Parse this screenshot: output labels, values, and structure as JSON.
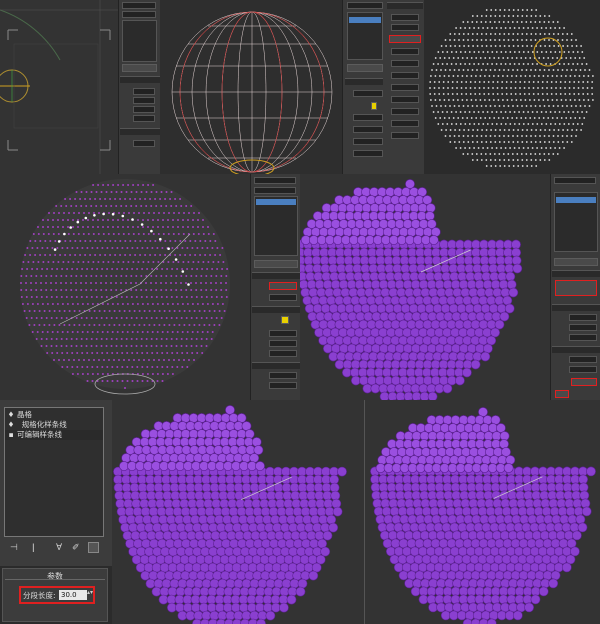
{
  "colors": {
    "viewport_bg": "#2f2f2f",
    "panel_bg": "#3a3a3a",
    "sphere_purple": "#8a3fd0",
    "highlight_red": "#e02020",
    "selection_blue": "#4a7fc0"
  },
  "icons": [
    "pin-icon",
    "light-bulb-icon",
    "funnel-icon",
    "edit-icon",
    "config-icon",
    "teapot-icon",
    "gizmo-icon"
  ],
  "bottom_panel": {
    "stack_items": [
      {
        "label": "晶格",
        "icon": "pin-icon"
      },
      {
        "label": "规格化样条线",
        "icon": "light-bulb-icon"
      },
      {
        "label": "可编辑样条线",
        "icon": "box-icon"
      }
    ],
    "rollout_title": "参数",
    "segment_length_label": "分段长度:",
    "segment_length_value": "30.0"
  }
}
